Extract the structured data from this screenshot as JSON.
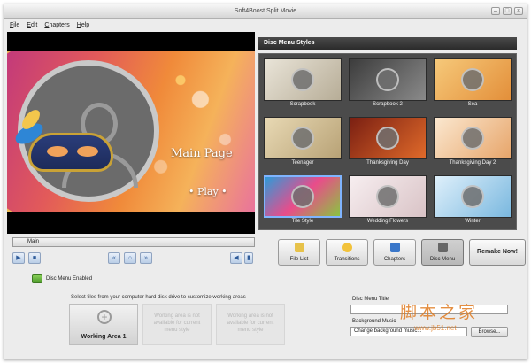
{
  "window": {
    "title": "Soft4Boost Split Movie"
  },
  "menu": [
    "File",
    "Edit",
    "Chapters",
    "Help"
  ],
  "preview": {
    "main_page": "Main Page",
    "play": "• Play •"
  },
  "timeline": {
    "label": "Main"
  },
  "styles": {
    "title": "Disc Menu Styles",
    "items": [
      {
        "label": "Scrapbook"
      },
      {
        "label": "Scrapbook 2"
      },
      {
        "label": "Sea"
      },
      {
        "label": "Teenager"
      },
      {
        "label": "Thanksgiving Day"
      },
      {
        "label": "Thanksgiving Day 2"
      },
      {
        "label": "Tile Style"
      },
      {
        "label": "Wedding Flowers"
      },
      {
        "label": "Winter"
      }
    ]
  },
  "actions": {
    "file_list": "File List",
    "transitions": "Transitions",
    "chapters": "Chapters",
    "disc_menu": "Disc Menu",
    "remake": "Remake Now!"
  },
  "disc_menu_enabled": "Disc Menu Enabled",
  "instructions": "Select files from your computer hard disk drive to customize working areas",
  "areas": {
    "area1": "Working Area 1",
    "na": "Working area is not available for current menu style"
  },
  "fields": {
    "title_label": "Disc Menu Title",
    "title_value": "",
    "music_label": "Background Music",
    "music_value": "Change background music...",
    "browse": "Browse..."
  },
  "watermark": {
    "text": "脚本之家",
    "url": "www.jb51.net"
  }
}
